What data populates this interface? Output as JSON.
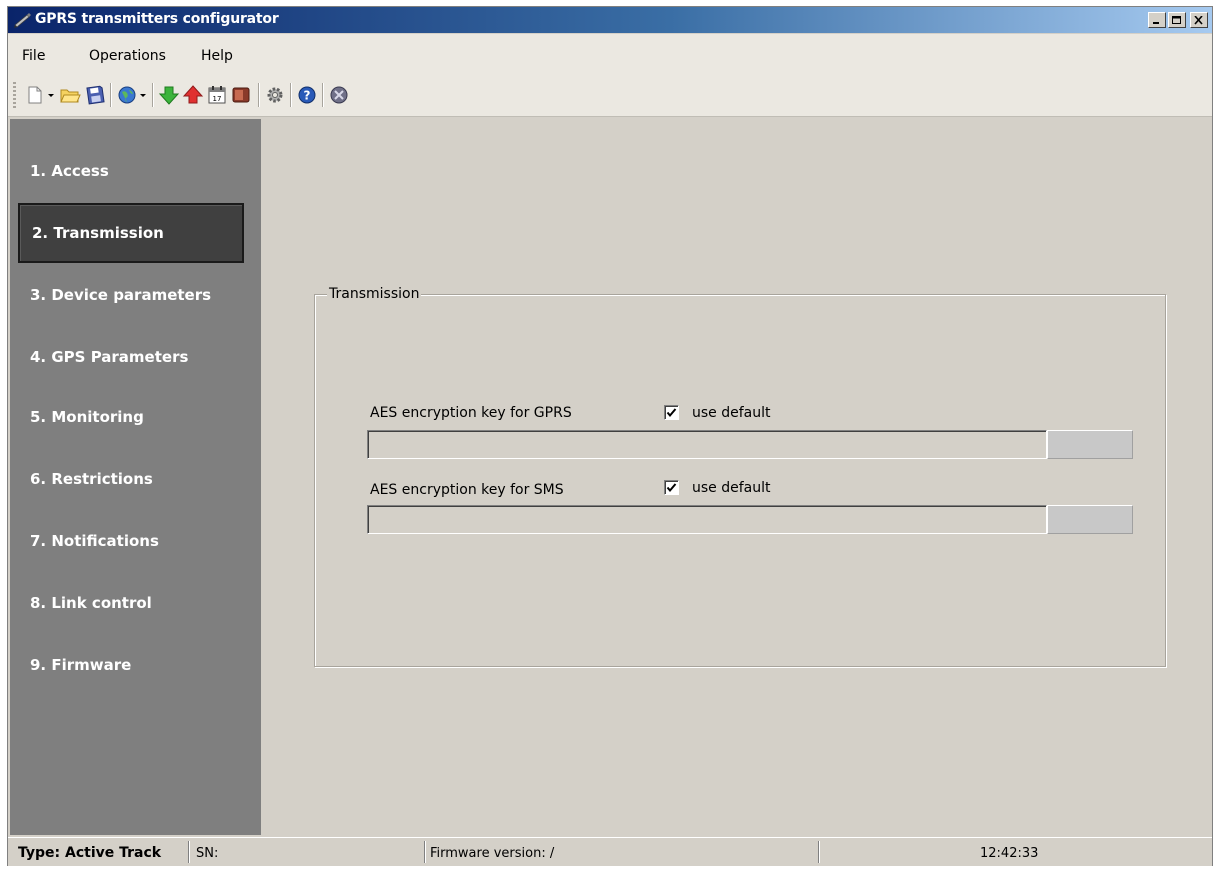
{
  "window": {
    "title": "GPRS transmitters configurator",
    "icon": "pen-icon"
  },
  "menubar": {
    "items": [
      {
        "label": "File"
      },
      {
        "label": "Operations"
      },
      {
        "label": "Help"
      }
    ]
  },
  "toolbar": {
    "icons": [
      "new-icon",
      "dropdown-arrow-icon",
      "open-folder-icon",
      "save-disk-icon",
      "globe-icon",
      "dropdown-arrow-icon",
      "download-arrow-icon",
      "upload-arrow-icon",
      "calendar-icon",
      "device-icon",
      "gear-icon",
      "help-icon",
      "exit-icon"
    ]
  },
  "sidebar": {
    "items": [
      {
        "label": "1. Access",
        "active": false
      },
      {
        "label": "2. Transmission",
        "active": true
      },
      {
        "label": "3. Device parameters",
        "active": false
      },
      {
        "label": "4. GPS Parameters",
        "active": false
      },
      {
        "label": "5. Monitoring",
        "active": false
      },
      {
        "label": "6. Restrictions",
        "active": false
      },
      {
        "label": "7. Notifications",
        "active": false
      },
      {
        "label": "8. Link control",
        "active": false
      },
      {
        "label": "9. Firmware",
        "active": false
      }
    ]
  },
  "transmission": {
    "group_title": "Transmission",
    "gprs_key": {
      "label": "AES encryption key for GPRS",
      "use_default_label": "use default",
      "use_default_checked": true,
      "value": ""
    },
    "sms_key": {
      "label": "AES encryption key for SMS",
      "use_default_label": "use default",
      "use_default_checked": true,
      "value": ""
    }
  },
  "statusbar": {
    "type": "Type: Active Track",
    "sn": "SN:",
    "firmware": "Firmware version: /",
    "time": "12:42:33"
  },
  "colors": {
    "titlebar_start": "#0a246a",
    "titlebar_end": "#a6caf0",
    "sidebar_bg": "#7f7f7f",
    "sidebar_active": "#404040",
    "panel_bg": "#d4d0c8"
  }
}
